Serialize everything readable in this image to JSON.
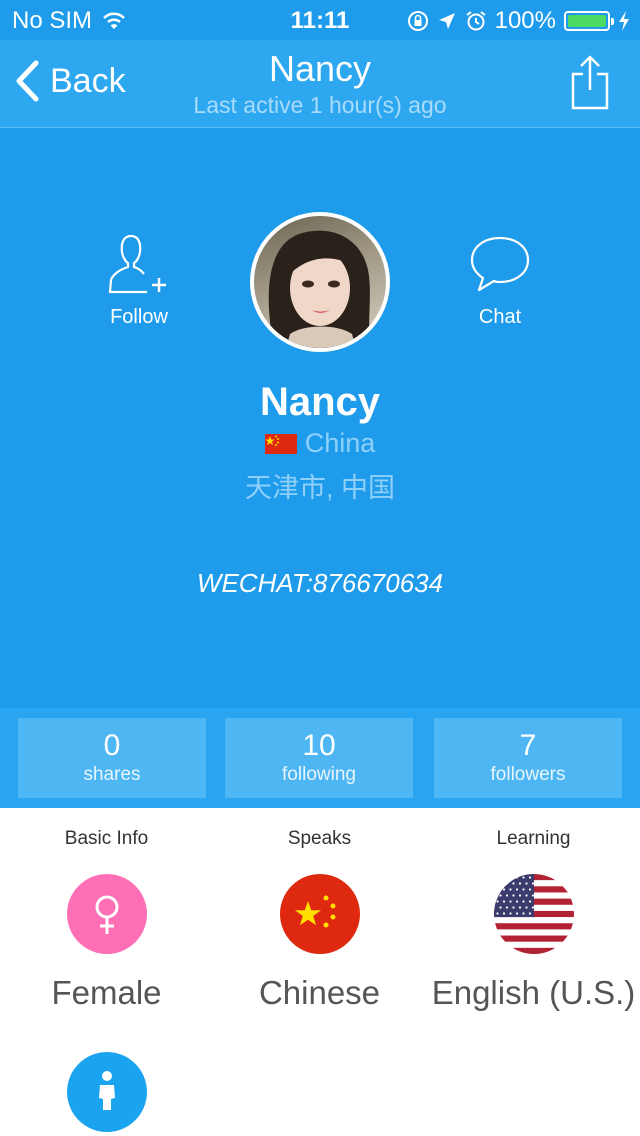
{
  "status_bar": {
    "carrier": "No SIM",
    "time": "11:11",
    "battery": "100%",
    "battery_level": 1.0
  },
  "nav": {
    "back_label": "Back",
    "title": "Nancy",
    "subtitle": "Last active 1 hour(s) ago"
  },
  "profile": {
    "follow_label": "Follow",
    "chat_label": "Chat",
    "name": "Nancy",
    "country": "China",
    "city": "天津市, 中国",
    "wechat": "WECHAT:876670634"
  },
  "stats": [
    {
      "value": "0",
      "label": "shares"
    },
    {
      "value": "10",
      "label": "following"
    },
    {
      "value": "7",
      "label": "followers"
    }
  ],
  "info": {
    "basic_info_heading": "Basic Info",
    "speaks_heading": "Speaks",
    "learning_heading": "Learning",
    "gender": "Female",
    "speaks": "Chinese",
    "learning": "English (U.S.)"
  },
  "colors": {
    "primary": "#1e9bea",
    "navbar": "#2da7ef",
    "female_pink": "#ff6fb5",
    "child_blue": "#1aa3ee"
  }
}
